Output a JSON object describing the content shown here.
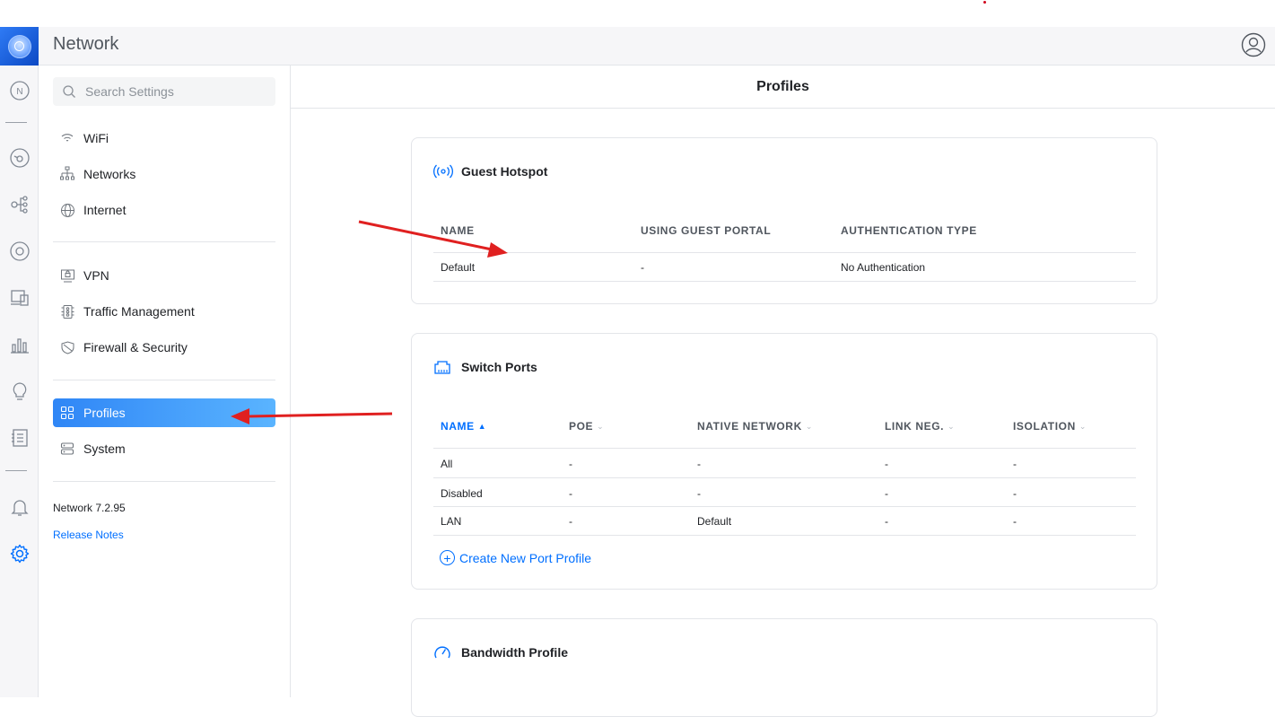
{
  "app": {
    "title": "Network"
  },
  "search": {
    "placeholder": "Search Settings"
  },
  "sidebar": {
    "items": [
      {
        "label": "WiFi",
        "icon": "wifi-icon"
      },
      {
        "label": "Networks",
        "icon": "network-tree-icon"
      },
      {
        "label": "Internet",
        "icon": "globe-icon"
      },
      {
        "label": "VPN",
        "icon": "vpn-icon"
      },
      {
        "label": "Traffic Management",
        "icon": "traffic-icon"
      },
      {
        "label": "Firewall & Security",
        "icon": "shield-icon"
      },
      {
        "label": "Profiles",
        "icon": "profiles-icon",
        "active": true
      },
      {
        "label": "System",
        "icon": "system-icon"
      }
    ],
    "version": "Network 7.2.95",
    "release_notes": "Release Notes"
  },
  "rail": {
    "icons": [
      "unifi-logo-icon",
      "network-app-icon",
      "dashboard-icon",
      "topology-icon",
      "devices-icon",
      "clients-icon",
      "insights-icon",
      "statistics-icon",
      "logs-icon",
      "alarms-bell-icon",
      "settings-gear-icon"
    ]
  },
  "main": {
    "title": "Profiles",
    "guest_hotspot": {
      "title": "Guest Hotspot",
      "headers": [
        "NAME",
        "USING GUEST PORTAL",
        "AUTHENTICATION TYPE"
      ],
      "rows": [
        [
          "Default",
          "-",
          "No Authentication"
        ]
      ]
    },
    "switch_ports": {
      "title": "Switch Ports",
      "headers": [
        "NAME",
        "POE",
        "NATIVE NETWORK",
        "LINK NEG.",
        "ISOLATION"
      ],
      "sorted_column": "NAME",
      "rows": [
        [
          "All",
          "-",
          "-",
          "-",
          "-"
        ],
        [
          "Disabled",
          "-",
          "-",
          "-",
          "-"
        ],
        [
          "LAN",
          "-",
          "Default",
          "-",
          "-"
        ]
      ],
      "create_label": "Create New Port Profile"
    },
    "bandwidth_profile": {
      "title": "Bandwidth Profile"
    }
  },
  "colors": {
    "accent": "#006fff",
    "annotation_arrow": "#e02020",
    "active_nav_gradient_start": "#2f86f6",
    "active_nav_gradient_end": "#5ab4ff"
  }
}
